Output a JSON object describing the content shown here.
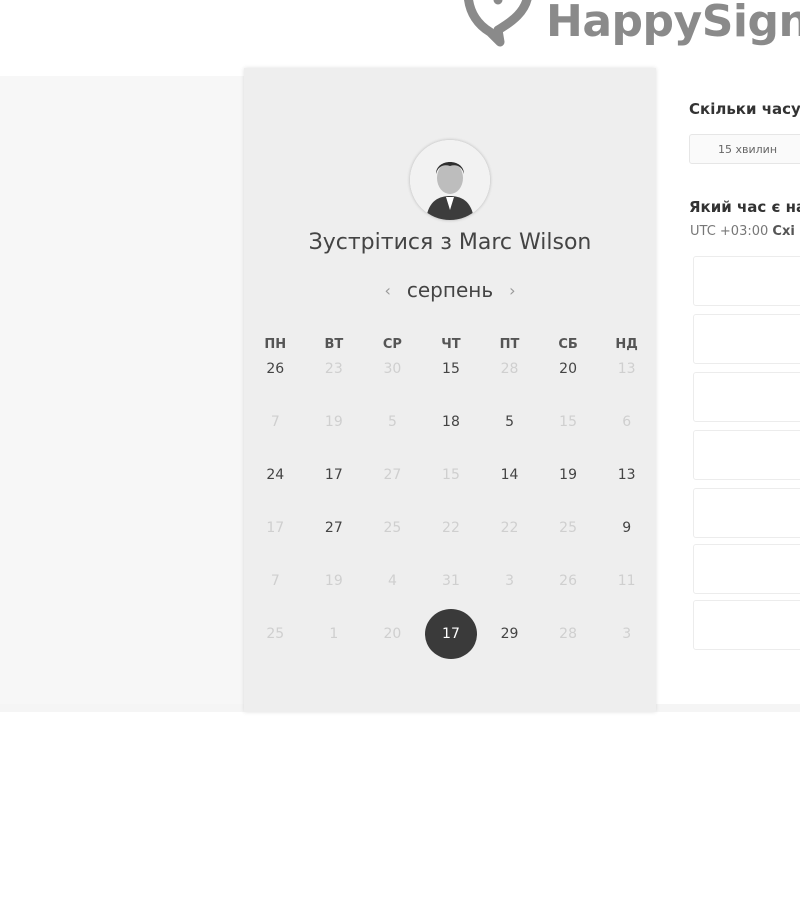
{
  "brand": {
    "name": "HappySigna",
    "logo_icon": "heart-speech-bubble-icon"
  },
  "scheduler": {
    "title": "Зустрітися з Marc Wilson",
    "avatar_icon": "user-avatar",
    "month": "серпень",
    "prev_icon": "chevron-left-icon",
    "next_icon": "chevron-right-icon",
    "prev_glyph": "‹",
    "next_glyph": "›",
    "weekdays": [
      "ПН",
      "ВТ",
      "СР",
      "ЧТ",
      "ПТ",
      "СБ",
      "НД"
    ],
    "weeks": [
      [
        {
          "d": "26",
          "m": false
        },
        {
          "d": "23",
          "m": true
        },
        {
          "d": "30",
          "m": true
        },
        {
          "d": "15",
          "m": false
        },
        {
          "d": "28",
          "m": true
        },
        {
          "d": "20",
          "m": false
        },
        {
          "d": "13",
          "m": true
        }
      ],
      [
        {
          "d": "7",
          "m": true
        },
        {
          "d": "19",
          "m": true
        },
        {
          "d": "5",
          "m": true
        },
        {
          "d": "18",
          "m": false
        },
        {
          "d": "5",
          "m": false
        },
        {
          "d": "15",
          "m": true
        },
        {
          "d": "6",
          "m": true
        }
      ],
      [
        {
          "d": "24",
          "m": false
        },
        {
          "d": "17",
          "m": false
        },
        {
          "d": "27",
          "m": true
        },
        {
          "d": "15",
          "m": true
        },
        {
          "d": "14",
          "m": false
        },
        {
          "d": "19",
          "m": false
        },
        {
          "d": "13",
          "m": false
        }
      ],
      [
        {
          "d": "17",
          "m": true
        },
        {
          "d": "27",
          "m": false
        },
        {
          "d": "25",
          "m": true
        },
        {
          "d": "22",
          "m": true
        },
        {
          "d": "22",
          "m": true
        },
        {
          "d": "25",
          "m": true
        },
        {
          "d": "9",
          "m": false
        }
      ],
      [
        {
          "d": "7",
          "m": true
        },
        {
          "d": "19",
          "m": true
        },
        {
          "d": "4",
          "m": true
        },
        {
          "d": "31",
          "m": true
        },
        {
          "d": "3",
          "m": true
        },
        {
          "d": "26",
          "m": true
        },
        {
          "d": "11",
          "m": true
        }
      ],
      [
        {
          "d": "25",
          "m": true
        },
        {
          "d": "1",
          "m": true
        },
        {
          "d": "20",
          "m": true
        },
        {
          "d": "17",
          "m": false,
          "selected": true
        },
        {
          "d": "29",
          "m": false
        },
        {
          "d": "28",
          "m": true
        },
        {
          "d": "3",
          "m": true
        }
      ]
    ]
  },
  "booking": {
    "duration_question": "Скільки часу",
    "duration_option": "15 хвилин",
    "time_question": "Який час є на",
    "timezone_prefix": "UTC +03:00",
    "timezone_name": "Схі"
  },
  "colors": {
    "selected_day": "#3a3a3a",
    "panel": "#eeeeee"
  }
}
